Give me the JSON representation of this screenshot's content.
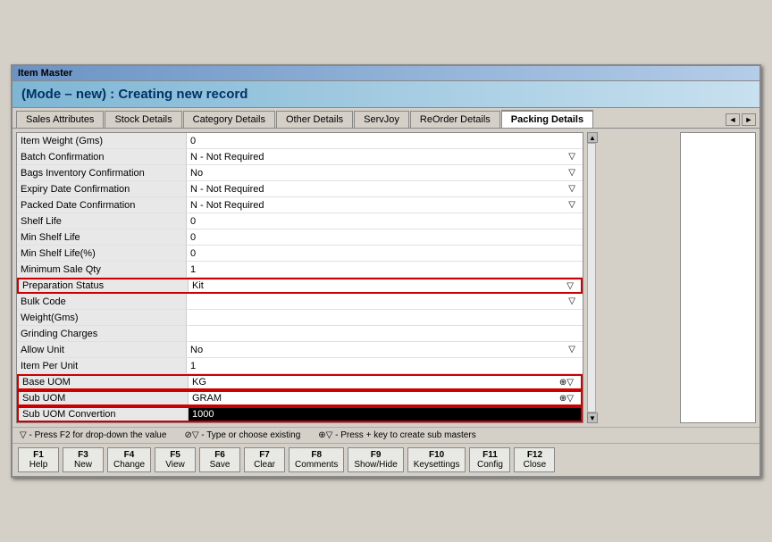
{
  "window": {
    "title": "Item Master",
    "mode_label": "(Mode – new) : Creating new record"
  },
  "tabs": [
    {
      "id": "sales",
      "label": "Sales Attributes",
      "active": false
    },
    {
      "id": "stock",
      "label": "Stock Details",
      "active": false
    },
    {
      "id": "category",
      "label": "Category Details",
      "active": false
    },
    {
      "id": "other",
      "label": "Other Details",
      "active": false
    },
    {
      "id": "servjoy",
      "label": "ServJoy",
      "active": false
    },
    {
      "id": "reorder",
      "label": "ReOrder Details",
      "active": false
    },
    {
      "id": "packing",
      "label": "Packing Details",
      "active": true
    }
  ],
  "fields": [
    {
      "label": "Item Weight (Gms)",
      "value": "0",
      "dropdown": false,
      "highlighted": false,
      "dark": false
    },
    {
      "label": "Batch Confirmation",
      "value": "N - Not Required",
      "dropdown": true,
      "highlighted": false,
      "dark": false
    },
    {
      "label": "Bags Inventory Confirmation",
      "value": "No",
      "dropdown": true,
      "highlighted": false,
      "dark": false
    },
    {
      "label": "Expiry Date Confirmation",
      "value": "N - Not Required",
      "dropdown": true,
      "highlighted": false,
      "dark": false
    },
    {
      "label": "Packed Date Confirmation",
      "value": "N - Not Required",
      "dropdown": true,
      "highlighted": false,
      "dark": false
    },
    {
      "label": "Shelf Life",
      "value": "0",
      "dropdown": false,
      "highlighted": false,
      "dark": false
    },
    {
      "label": "Min Shelf Life",
      "value": "0",
      "dropdown": false,
      "highlighted": false,
      "dark": false
    },
    {
      "label": "Min Shelf Life(%)",
      "value": "0",
      "dropdown": false,
      "highlighted": false,
      "dark": false
    },
    {
      "label": "Minimum Sale Qty",
      "value": "1",
      "dropdown": false,
      "highlighted": false,
      "dark": false
    },
    {
      "label": "Preparation Status",
      "value": "Kit",
      "dropdown": true,
      "highlighted": true,
      "dark": false
    },
    {
      "label": "Bulk Code",
      "value": "",
      "dropdown": true,
      "highlighted": false,
      "dark": false
    },
    {
      "label": "Weight(Gms)",
      "value": "",
      "dropdown": false,
      "highlighted": false,
      "dark": false
    },
    {
      "label": "Grinding Charges",
      "value": "",
      "dropdown": false,
      "highlighted": false,
      "dark": false
    },
    {
      "label": "Allow Unit",
      "value": "No",
      "dropdown": true,
      "highlighted": false,
      "dark": false
    },
    {
      "label": "Item Per Unit",
      "value": "1",
      "dropdown": false,
      "highlighted": false,
      "dark": false
    },
    {
      "label": "Base UOM",
      "value": "KG",
      "dropdown": true,
      "highlighted": true,
      "dark": false,
      "plus": true
    },
    {
      "label": "Sub UOM",
      "value": "GRAM",
      "dropdown": true,
      "highlighted": true,
      "dark": false,
      "plus": true
    },
    {
      "label": "Sub UOM Convertion",
      "value": "1000",
      "dropdown": false,
      "highlighted": true,
      "dark": true
    }
  ],
  "legend": [
    {
      "symbol": "▽",
      "text": "- Press F2 for drop-down the value"
    },
    {
      "symbol": "⊘▽",
      "text": "- Type or choose existing"
    },
    {
      "symbol": "⊕▽",
      "text": "- Press + key to create sub masters"
    }
  ],
  "function_keys": [
    {
      "fn": "F1",
      "label": "Help"
    },
    {
      "fn": "F3",
      "label": "New"
    },
    {
      "fn": "F4",
      "label": "Change"
    },
    {
      "fn": "F5",
      "label": "View"
    },
    {
      "fn": "F6",
      "label": "Save"
    },
    {
      "fn": "F7",
      "label": "Clear"
    },
    {
      "fn": "F8",
      "label": "Comments"
    },
    {
      "fn": "F9",
      "label": "Show/Hide"
    },
    {
      "fn": "F10",
      "label": "Keysettings"
    },
    {
      "fn": "F11",
      "label": "Config"
    },
    {
      "fn": "F12",
      "label": "Close"
    }
  ]
}
